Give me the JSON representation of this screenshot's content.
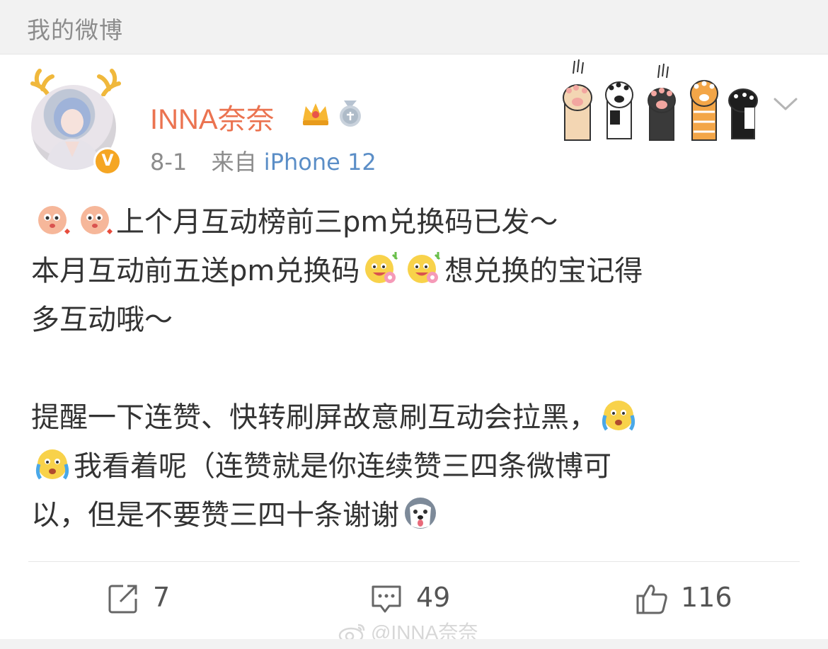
{
  "header": {
    "title": "我的微博"
  },
  "post": {
    "author": {
      "name": "INNA奈奈",
      "verified_badge": "V",
      "badges": [
        "crown-icon",
        "medal-icon"
      ],
      "decoration": "cat-paws-banner"
    },
    "meta": {
      "date": "8-1",
      "source_prefix": "来自",
      "source_device": "iPhone 12"
    },
    "content": {
      "lines": [
        "上个月互动榜前三pm兑换码已发～",
        "本月互动前五送pm兑换码",
        "想兑换的宝记得",
        "多互动哦～",
        "提醒一下连赞、快转刷屏故意刷互动会拉黑，",
        "我看着呢（连赞就是你连续赞三四条微博可",
        "以，但是不要赞三四十条谢谢"
      ],
      "emoji": [
        "kiss-emoji",
        "flower-smile-emoji",
        "crying-emoji",
        "husky-emoji"
      ]
    },
    "actions": {
      "repost_count": "7",
      "comment_count": "49",
      "like_count": "116"
    }
  },
  "watermark": {
    "text": "@INNA奈奈"
  },
  "colors": {
    "username": "#eb7350",
    "source_link": "#5b8ec7",
    "muted": "#8c8c8c"
  }
}
